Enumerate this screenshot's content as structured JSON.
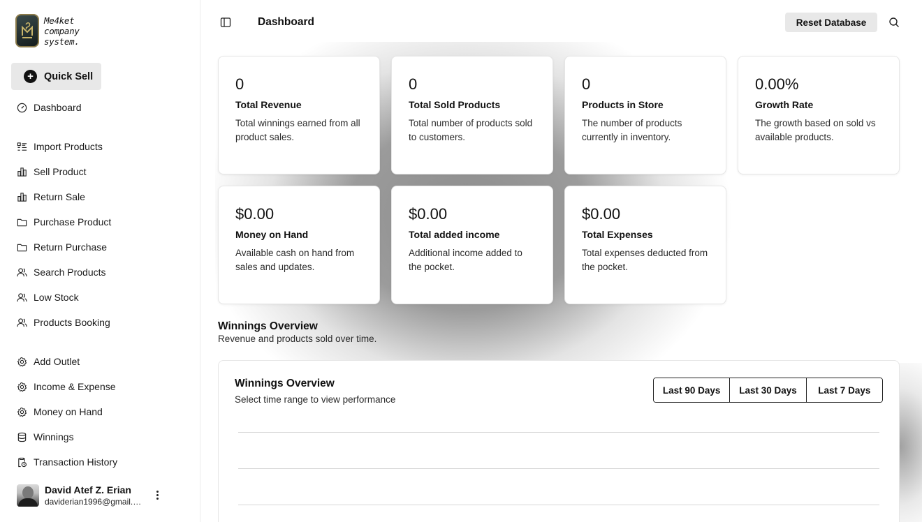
{
  "sidebar": {
    "logo_text": "Me4ket company system.",
    "quick_sell_label": "Quick Sell",
    "items": [
      {
        "label": "Dashboard",
        "icon": "gauge-icon"
      },
      {
        "label": "Import Products",
        "icon": "list-icon"
      },
      {
        "label": "Sell Product",
        "icon": "chart-icon"
      },
      {
        "label": "Return Sale",
        "icon": "chart-icon"
      },
      {
        "label": "Purchase Product",
        "icon": "folder-icon"
      },
      {
        "label": "Return Purchase",
        "icon": "folder-icon"
      },
      {
        "label": "Search Products",
        "icon": "users-icon"
      },
      {
        "label": "Low Stock",
        "icon": "users-icon"
      },
      {
        "label": "Products Booking",
        "icon": "users-icon"
      },
      {
        "label": "Add Outlet",
        "icon": "gear-icon"
      },
      {
        "label": "Income & Expense",
        "icon": "gear-icon"
      },
      {
        "label": "Money on Hand",
        "icon": "gear-icon"
      },
      {
        "label": "Winnings",
        "icon": "database-icon"
      },
      {
        "label": "Transaction History",
        "icon": "clipboard-clock-icon"
      }
    ],
    "user": {
      "name": "David Atef Z. Erian",
      "email": "daviderian1996@gmail.c..."
    }
  },
  "header": {
    "title": "Dashboard",
    "reset_label": "Reset Database"
  },
  "stats": [
    {
      "value": "0",
      "title": "Total Revenue",
      "desc": "Total winnings earned from all product sales."
    },
    {
      "value": "0",
      "title": "Total Sold Products",
      "desc": "Total number of products sold to customers."
    },
    {
      "value": "0",
      "title": "Products in Store",
      "desc": "The number of products currently in inventory."
    },
    {
      "value": "0.00%",
      "title": "Growth Rate",
      "desc": "The growth based on sold vs available products."
    },
    {
      "value": "$0.00",
      "title": "Money on Hand",
      "desc": "Available cash on hand from sales and updates."
    },
    {
      "value": "$0.00",
      "title": "Total added income",
      "desc": "Additional income added to the pocket."
    },
    {
      "value": "$0.00",
      "title": "Total Expenses",
      "desc": "Total expenses deducted from the pocket."
    }
  ],
  "overview": {
    "title": "Winnings Overview",
    "subtitle": "Revenue and products sold over time."
  },
  "chart": {
    "title": "Winnings Overview",
    "subtitle": "Select time range to view performance",
    "ranges": [
      "Last 90 Days",
      "Last 30 Days",
      "Last 7 Days"
    ]
  }
}
